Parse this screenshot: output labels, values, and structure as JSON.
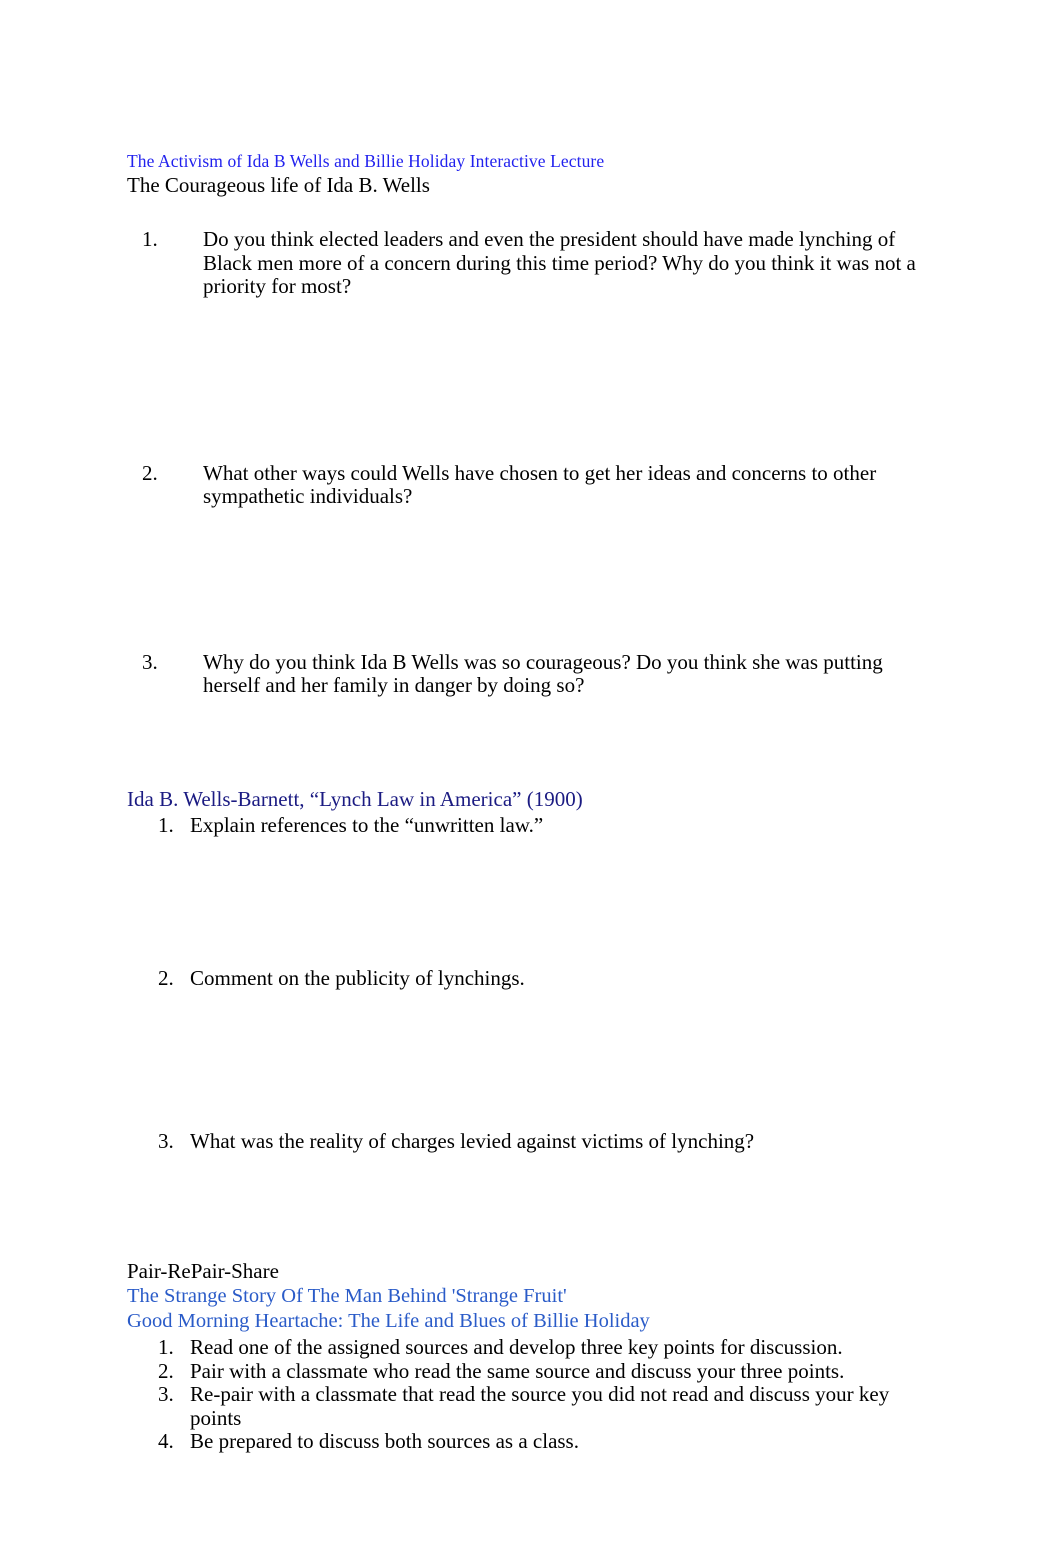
{
  "document": {
    "top_link": "The Activism of Ida B Wells and Billie Holiday Interactive Lecture",
    "subtitle": "The Courageous life of Ida B. Wells",
    "colors": {
      "link_bright_blue": "#2222ee",
      "link_navy": "#1b1b82",
      "link_royal_blue": "#2a5bc8",
      "body_text": "#000000",
      "page_background": "#ffffff"
    }
  },
  "section_one": {
    "questions": [
      {
        "number": "1.",
        "text": "Do you think elected leaders and even the president should have made lynching of Black men more of a concern during this time period? Why do you think it was not a priority for most?"
      },
      {
        "number": "2.",
        "text": "What other ways could Wells have chosen to get her ideas and concerns to other sympathetic individuals?"
      },
      {
        "number": "3.",
        "text": "Why do you think Ida B Wells was so courageous? Do you think she was putting herself and her family in danger by doing so?"
      }
    ]
  },
  "section_two": {
    "heading_link": "Ida B. Wells-Barnett, “Lynch Law in America” (1900)",
    "questions": [
      {
        "number": "1.",
        "text": "Explain references to the “unwritten law.”"
      },
      {
        "number": "2.",
        "text": "Comment on the publicity of lynchings."
      },
      {
        "number": "3.",
        "text": "What was the reality of  charges levied against victims of lynching?"
      }
    ]
  },
  "section_three": {
    "heading": "Pair-RePair-Share",
    "links": [
      "The Strange Story Of The Man Behind 'Strange Fruit'",
      "Good Morning Heartache: The Life and Blues of Billie Holiday"
    ],
    "steps": [
      {
        "number": "1.",
        "text": "Read one of the assigned sources and develop three key points for discussion."
      },
      {
        "number": "2.",
        "text": "Pair with a classmate who read the same source and discuss your three points."
      },
      {
        "number": "3.",
        "text": "Re-pair with a classmate that read the source you did not read and discuss your key points"
      },
      {
        "number": "4.",
        "text": "Be prepared to discuss both sources as a class."
      }
    ]
  }
}
